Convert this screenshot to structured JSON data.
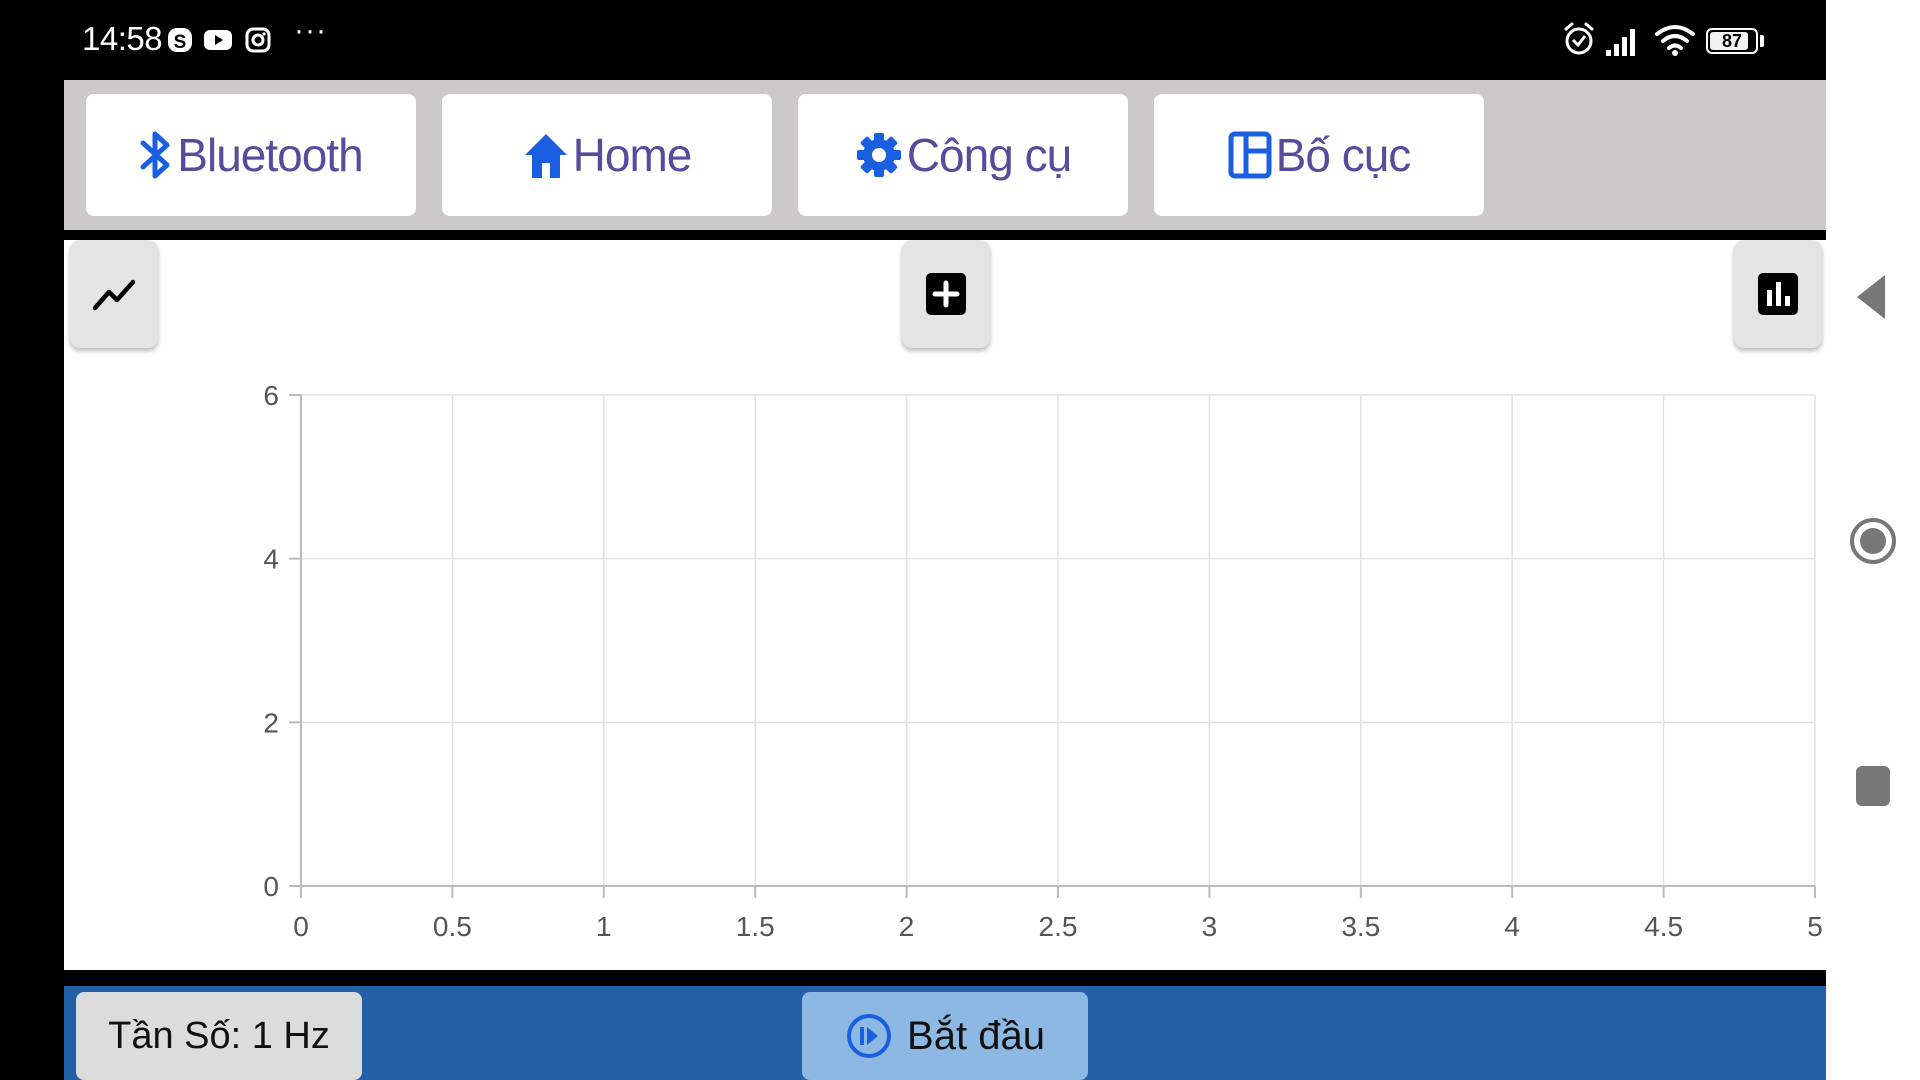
{
  "status_bar": {
    "time": "14:58",
    "app_icons": [
      "skype-icon",
      "youtube-icon",
      "instagram-icon"
    ],
    "more": "···",
    "battery_level": 87,
    "battery_text": "87"
  },
  "toolbar": {
    "bluetooth_label": "Bluetooth",
    "home_label": "Home",
    "tools_label": "Công cụ",
    "layout_label": "Bố cục"
  },
  "chart_data": {
    "type": "line",
    "series": [],
    "xlim": [
      0,
      5
    ],
    "ylim": [
      0,
      6
    ],
    "x_ticks": [
      "0",
      "0.5",
      "1",
      "1.5",
      "2",
      "2.5",
      "3",
      "3.5",
      "4",
      "4.5",
      "5"
    ],
    "y_ticks": [
      "0",
      "2",
      "4",
      "6"
    ],
    "grid": true
  },
  "bottom_bar": {
    "frequency_label": "Tần Số: 1 Hz",
    "start_label": "Bắt đầu"
  },
  "colors": {
    "accent_icon": "#1a5fe0",
    "button_text": "#5a4a9c",
    "bottom_bar": "#2460a8",
    "start_button": "#8db8e4"
  }
}
